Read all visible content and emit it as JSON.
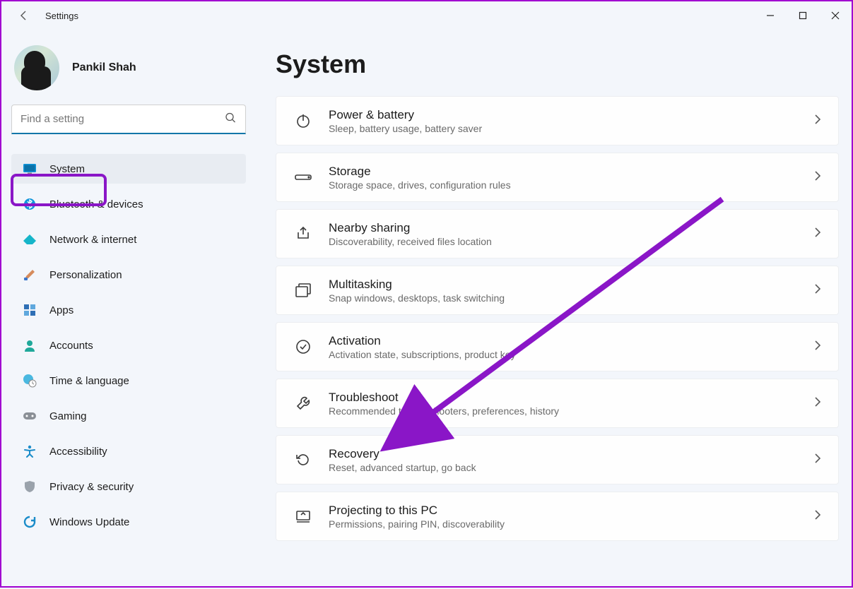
{
  "window": {
    "title": "Settings"
  },
  "user": {
    "name": "Pankil Shah"
  },
  "search": {
    "placeholder": "Find a setting"
  },
  "nav": [
    {
      "id": "system",
      "label": "System",
      "icon": "monitor-icon",
      "selected": true
    },
    {
      "id": "bluetooth",
      "label": "Bluetooth & devices",
      "icon": "bluetooth-icon",
      "selected": false
    },
    {
      "id": "network",
      "label": "Network & internet",
      "icon": "wifi-icon",
      "selected": false
    },
    {
      "id": "personalization",
      "label": "Personalization",
      "icon": "paintbrush-icon",
      "selected": false
    },
    {
      "id": "apps",
      "label": "Apps",
      "icon": "apps-icon",
      "selected": false
    },
    {
      "id": "accounts",
      "label": "Accounts",
      "icon": "person-icon",
      "selected": false
    },
    {
      "id": "time",
      "label": "Time & language",
      "icon": "globe-clock-icon",
      "selected": false
    },
    {
      "id": "gaming",
      "label": "Gaming",
      "icon": "gamepad-icon",
      "selected": false
    },
    {
      "id": "accessibility",
      "label": "Accessibility",
      "icon": "accessibility-icon",
      "selected": false
    },
    {
      "id": "privacy",
      "label": "Privacy & security",
      "icon": "shield-icon",
      "selected": false
    },
    {
      "id": "update",
      "label": "Windows Update",
      "icon": "update-icon",
      "selected": false
    }
  ],
  "page": {
    "title": "System"
  },
  "system_items": [
    {
      "id": "power",
      "title": "Power & battery",
      "subtitle": "Sleep, battery usage, battery saver",
      "icon": "power-icon"
    },
    {
      "id": "storage",
      "title": "Storage",
      "subtitle": "Storage space, drives, configuration rules",
      "icon": "storage-icon"
    },
    {
      "id": "nearby",
      "title": "Nearby sharing",
      "subtitle": "Discoverability, received files location",
      "icon": "share-icon"
    },
    {
      "id": "multitasking",
      "title": "Multitasking",
      "subtitle": "Snap windows, desktops, task switching",
      "icon": "windows-icon"
    },
    {
      "id": "activation",
      "title": "Activation",
      "subtitle": "Activation state, subscriptions, product key",
      "icon": "checkmark-circle-icon"
    },
    {
      "id": "troubleshoot",
      "title": "Troubleshoot",
      "subtitle": "Recommended troubleshooters, preferences, history",
      "icon": "wrench-icon"
    },
    {
      "id": "recovery",
      "title": "Recovery",
      "subtitle": "Reset, advanced startup, go back",
      "icon": "recovery-icon"
    },
    {
      "id": "projecting",
      "title": "Projecting to this PC",
      "subtitle": "Permissions, pairing PIN, discoverability",
      "icon": "project-icon"
    }
  ],
  "annotation": {
    "highlight_nav_item": "system",
    "arrow_target_item": "troubleshoot",
    "color": "#8a16c7"
  }
}
